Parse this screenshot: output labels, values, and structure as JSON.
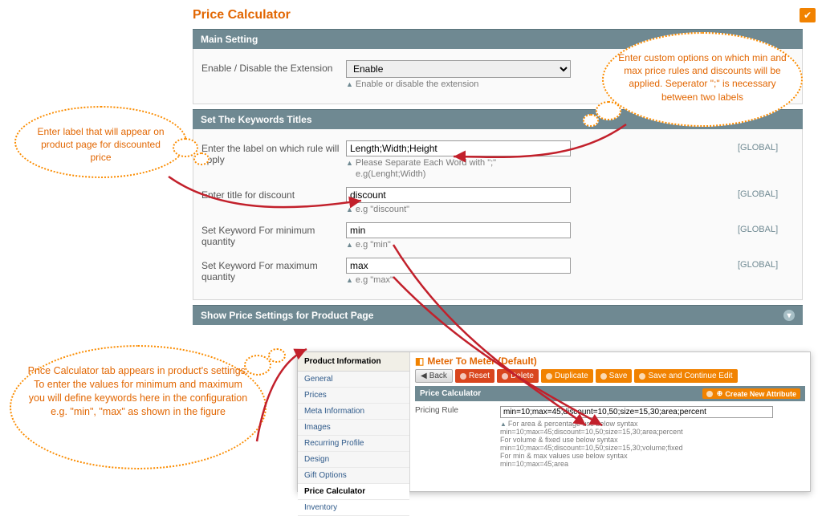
{
  "title": "Price Calculator",
  "sections": {
    "main_setting": {
      "header": "Main Setting",
      "enable_label": "Enable / Disable the Extension",
      "enable_value": "Enable",
      "enable_hint": "Enable or disable the extension"
    },
    "keywords": {
      "header": "Set The Keywords Titles",
      "scope_label": "[GLOBAL]",
      "rows": [
        {
          "label": "Enter the label on which rule will apply",
          "value": "Length;Width;Height",
          "hint1": "Please Separate Each Word with \";\"",
          "hint2": "e.g(Lenght;Width)"
        },
        {
          "label": "Enter title for discount",
          "value": "discount",
          "hint1": "e.g \"discount\"",
          "hint2": ""
        },
        {
          "label": "Set Keyword For minimum quantity",
          "value": "min",
          "hint1": "e.g \"min\"",
          "hint2": ""
        },
        {
          "label": "Set Keyword For maximum quantity",
          "value": "max",
          "hint1": "e.g \"max\"",
          "hint2": ""
        }
      ]
    },
    "show_price": {
      "header": "Show Price Settings for Product Page"
    }
  },
  "inset": {
    "side_header": "Product Information",
    "side_items": [
      "General",
      "Prices",
      "Meta Information",
      "Images",
      "Recurring Profile",
      "Design",
      "Gift Options",
      "Price Calculator",
      "Inventory"
    ],
    "active_item": "Price Calculator",
    "title": "Meter To Meter (Default)",
    "buttons": {
      "back": "Back",
      "reset": "Reset",
      "delete": "Delete",
      "duplicate": "Duplicate",
      "save": "Save",
      "save_continue": "Save and Continue Edit",
      "create_attr": "Create New Attribute"
    },
    "section_header": "Price Calculator",
    "pricing_rule_label": "Pricing Rule",
    "pricing_rule_value": "min=10;max=45;discount=10,50;size=15,30;area;percent",
    "hints": [
      "For area & percentage use below syntax",
      "min=10;max=45;discount=10,50;size=15,30;area;percent",
      "For volume & fixed use below syntax",
      "min=10;max=45;discount=10,50;size=15,30;volume;fixed",
      "For min & max values use below syntax",
      "min=10;max=45;area"
    ]
  },
  "callouts": {
    "c1": "Enter label that will appear on product page for discounted price",
    "c2": "Enter custom options on which min and max price rules and discounts will be applied. Seperator \";\" is necessary between two labels",
    "c3": "Price Calculator tab appears in product's settings. To enter the values for minimum and maximum you will define keywords here in the configuration e.g. \"min\", \"max\" as shown in the figure"
  }
}
